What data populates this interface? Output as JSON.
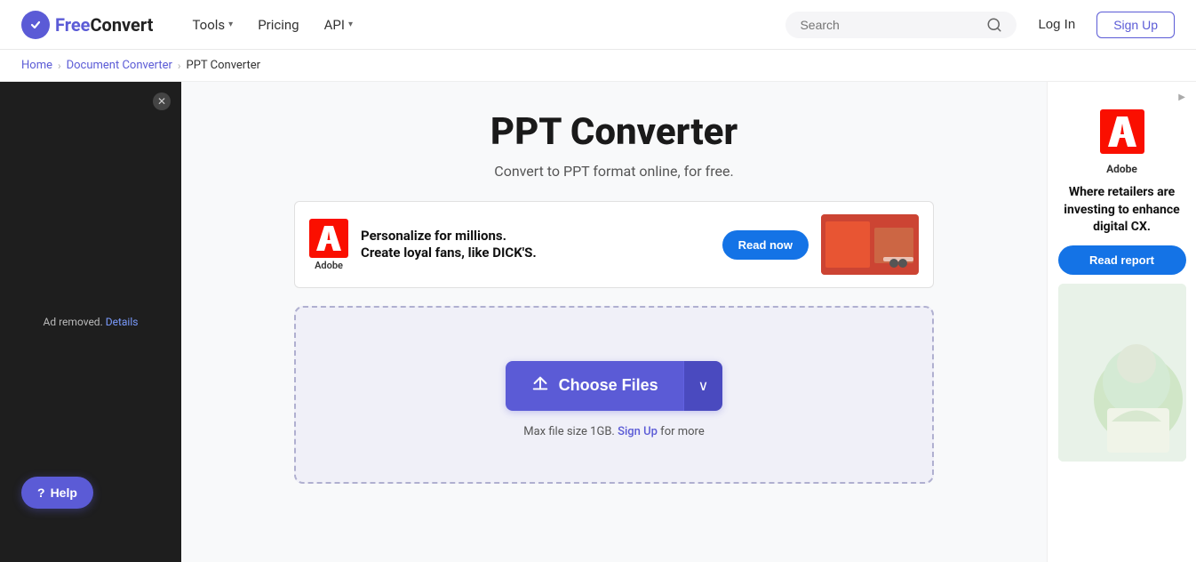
{
  "header": {
    "logo_free": "Free",
    "logo_convert": "Convert",
    "nav": [
      {
        "label": "Tools",
        "has_dropdown": true
      },
      {
        "label": "Pricing",
        "has_dropdown": false
      },
      {
        "label": "API",
        "has_dropdown": true
      }
    ],
    "search_placeholder": "Search",
    "login_label": "Log In",
    "signup_label": "Sign Up"
  },
  "breadcrumb": {
    "items": [
      {
        "label": "Home",
        "link": true
      },
      {
        "label": "Document Converter",
        "link": true
      },
      {
        "label": "PPT Converter",
        "link": false
      }
    ]
  },
  "main": {
    "title": "PPT Converter",
    "subtitle": "Convert to PPT format online, for free.",
    "ad_banner": {
      "headline_line1": "Personalize for millions.",
      "headline_line2": "Create loyal fans, like DICK'S.",
      "cta_label": "Read now"
    },
    "dropzone": {
      "choose_files_label": "Choose Files",
      "hint_prefix": "Max file size 1GB.",
      "hint_link_label": "Sign Up",
      "hint_suffix": "for more"
    }
  },
  "left_sidebar": {
    "ad_removed_label": "Ad removed.",
    "details_label": "Details"
  },
  "right_sidebar": {
    "ad_marker": "▶",
    "adobe_label": "Adobe",
    "headline": "Where retailers are investing to enhance digital CX.",
    "cta_label": "Read report"
  },
  "help": {
    "label": "Help"
  },
  "icons": {
    "question_mark": "?",
    "search": "🔍",
    "plus_file": "⊕",
    "chevron_down": "∨",
    "close": "✕"
  }
}
